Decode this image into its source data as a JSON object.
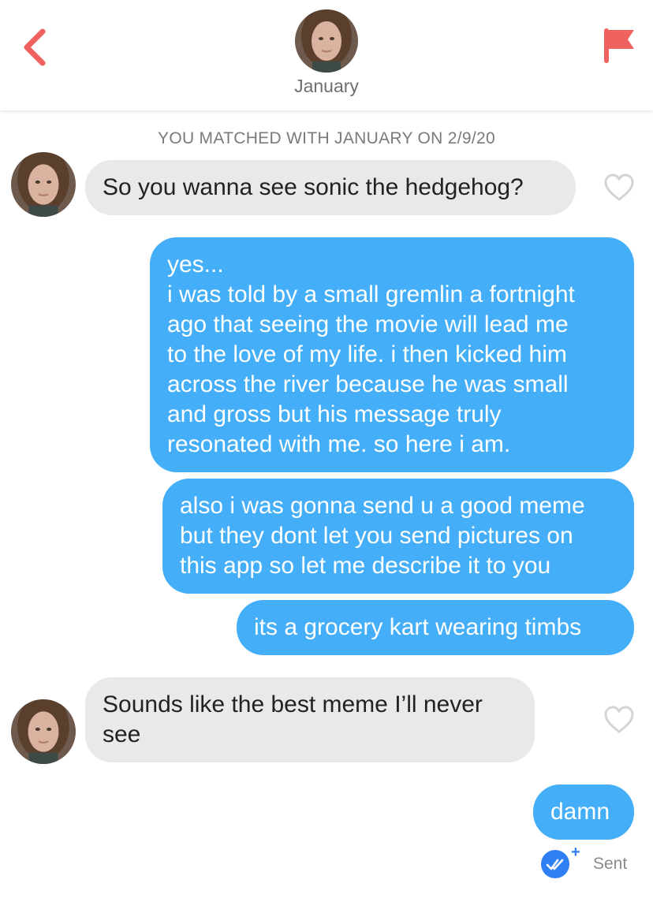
{
  "header": {
    "name": "January",
    "back_icon": "chevron-left-icon",
    "flag_icon": "flag-icon",
    "accent_color": "#f0625f"
  },
  "conversation": {
    "matched_text": "YOU MATCHED WITH JANUARY ON 2/9/20",
    "messages": [
      {
        "from": "them",
        "text": "So you wanna see sonic the hedgehog?"
      },
      {
        "from": "me",
        "text": "yes...\ni was told by a small gremlin a fortnight\nago that seeing the movie will lead me\nto the love of my life. i then kicked him\nacross the river because he was small\nand gross but his message truly\nresonated with me. so here i am."
      },
      {
        "from": "me",
        "text": "also i was gonna send u a good meme\nbut they dont let you send pictures on\nthis app so let me describe it to you"
      },
      {
        "from": "me",
        "text": "its a grocery kart wearing timbs"
      },
      {
        "from": "them",
        "text": "Sounds like the best meme I’ll never\nsee"
      },
      {
        "from": "me",
        "text": "damn"
      }
    ],
    "sent_status": "Sent",
    "sent_plus": "+",
    "outgoing_color": "#45aef8",
    "incoming_color": "#e9e9eb"
  }
}
